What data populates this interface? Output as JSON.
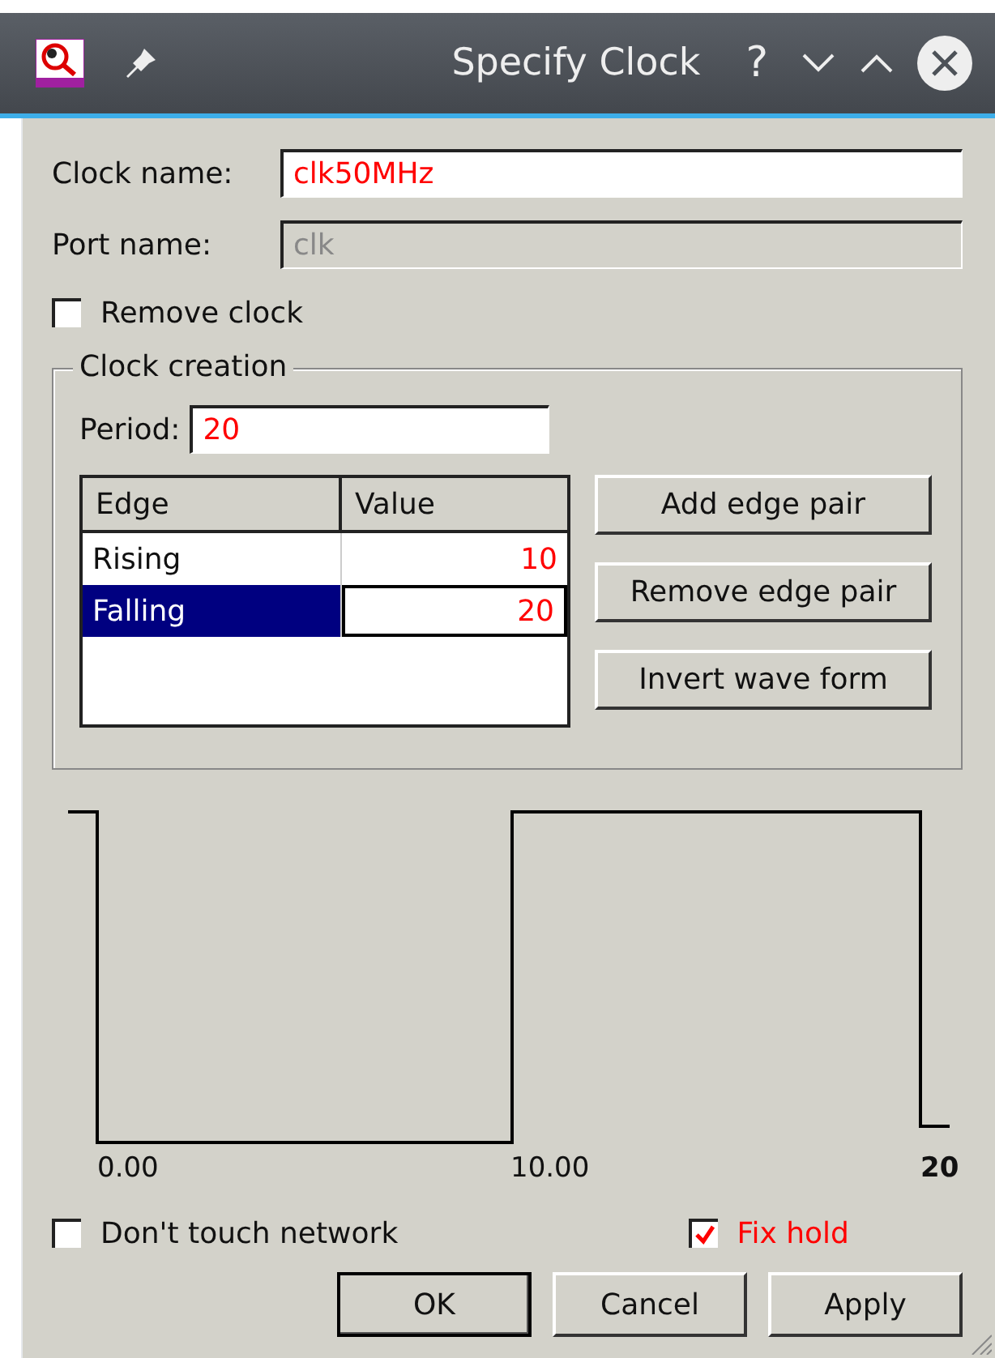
{
  "window": {
    "title": "Specify Clock",
    "help": "?"
  },
  "clock_name": {
    "label": "Clock name:",
    "value": "clk50MHz",
    "disabled": false
  },
  "port_name": {
    "label": "Port name:",
    "value": "clk",
    "disabled": true
  },
  "remove_clock": {
    "label": "Remove clock",
    "checked": false
  },
  "clock_creation": {
    "title": "Clock creation",
    "period": {
      "label": "Period:",
      "value": "20"
    },
    "table": {
      "columns": [
        "Edge",
        "Value"
      ],
      "rows": [
        {
          "edge": "Rising",
          "value": "10",
          "selected": false
        },
        {
          "edge": "Falling",
          "value": "20",
          "selected": true
        }
      ]
    },
    "buttons": [
      {
        "label": "Add edge pair"
      },
      {
        "label": "Remove edge pair"
      },
      {
        "label": "Invert wave form"
      }
    ]
  },
  "waveform": {
    "tick_labels": [
      "0.00",
      "10.00",
      "20"
    ]
  },
  "options": [
    {
      "label": "Don't touch network",
      "checked": false,
      "highlight": false
    },
    {
      "label": "Fix hold",
      "checked": true,
      "highlight": true
    }
  ],
  "buttons": [
    {
      "label": "OK",
      "default": true
    },
    {
      "label": "Cancel",
      "default": false
    },
    {
      "label": "Apply",
      "default": false
    }
  ]
}
